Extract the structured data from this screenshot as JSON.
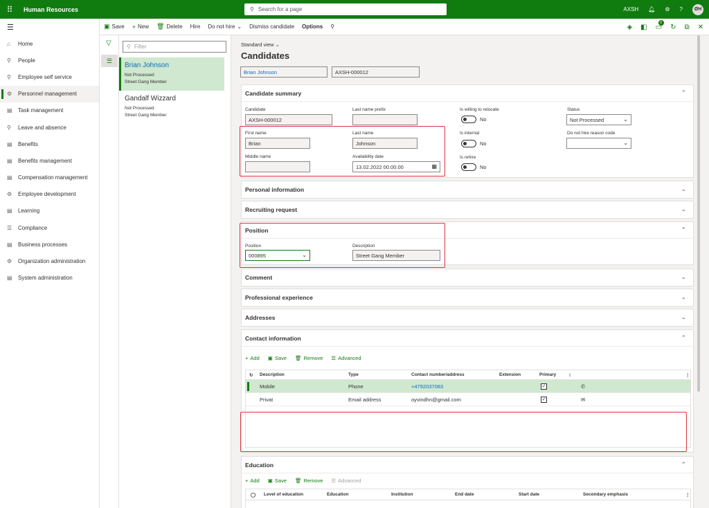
{
  "app": {
    "title": "Human Resources",
    "search_placeholder": "Search for a page",
    "company": "AXSH",
    "user_initials": "ØH"
  },
  "actions": {
    "save": "Save",
    "new": "New",
    "delete": "Delete",
    "hire": "Hire",
    "do_not_hire": "Do not hire",
    "dismiss": "Dismiss candidate",
    "options": "Options",
    "notif_count": "0"
  },
  "nav": {
    "items": [
      {
        "label": "Home",
        "icon": "⌂"
      },
      {
        "label": "People",
        "icon": "⚲"
      },
      {
        "label": "Employee self service",
        "icon": "⚲"
      },
      {
        "label": "Personnel management",
        "icon": "⚙"
      },
      {
        "label": "Task management",
        "icon": "▤"
      },
      {
        "label": "Leave and absence",
        "icon": "⚲"
      },
      {
        "label": "Benefits",
        "icon": "▤"
      },
      {
        "label": "Benefits management",
        "icon": "▤"
      },
      {
        "label": "Compensation management",
        "icon": "▤"
      },
      {
        "label": "Employee development",
        "icon": "⚙"
      },
      {
        "label": "Learning",
        "icon": "▤"
      },
      {
        "label": "Compliance",
        "icon": "☰"
      },
      {
        "label": "Business processes",
        "icon": "▤"
      },
      {
        "label": "Organization administration",
        "icon": "⚙"
      },
      {
        "label": "System administration",
        "icon": "▤"
      }
    ],
    "active": "Personnel management"
  },
  "list": {
    "filter_placeholder": "Filter",
    "records": [
      {
        "name": "Brian Johnson",
        "status": "Not Processed",
        "position": "Street Gang Member"
      },
      {
        "name": "Gandalf Wizzard",
        "status": "Not Processed",
        "position": "Street Gang Member"
      }
    ]
  },
  "page": {
    "view": "Standard view",
    "title": "Candidates",
    "header_name": "Brian Johnson",
    "header_id": "AXSH-000012"
  },
  "summary": {
    "title": "Candidate summary",
    "candidate_label": "Candidate",
    "candidate_value": "AXSH-000012",
    "last_name_prefix_label": "Last name prefix",
    "last_name_prefix_value": "",
    "first_name_label": "First name",
    "first_name_value": "Brian",
    "last_name_label": "Last name",
    "last_name_value": "Johnson",
    "middle_name_label": "Middle name",
    "middle_name_value": "",
    "availability_label": "Availability date",
    "availability_value": "13.02.2022 00.00.00",
    "relocate_label": "Is willing to relocate",
    "relocate_value": "No",
    "internal_label": "Is internal",
    "internal_value": "No",
    "rehire_label": "Is rehire",
    "rehire_value": "No",
    "status_label": "Status",
    "status_value": "Not Processed",
    "dnh_reason_label": "Do not hire reason code",
    "dnh_reason_value": ""
  },
  "sections": {
    "personal": "Personal information",
    "recruiting": "Recruiting request",
    "position": "Position",
    "comment": "Comment",
    "experience": "Professional experience",
    "addresses": "Addresses",
    "contact": "Contact information",
    "education": "Education"
  },
  "position": {
    "position_label": "Position",
    "position_value": "000895",
    "description_label": "Description",
    "description_value": "Street Gang Member"
  },
  "contact": {
    "tools": {
      "add": "Add",
      "save": "Save",
      "remove": "Remove",
      "advanced": "Advanced"
    },
    "columns": {
      "description": "Description",
      "type": "Type",
      "contact": "Contact number/address",
      "extension": "Extension",
      "primary": "Primary"
    },
    "rows": [
      {
        "description": "Mobile",
        "type": "Phone",
        "contact": "+4792037083",
        "extension": "",
        "primary": "✓",
        "icon": "phone-icon"
      },
      {
        "description": "Privat",
        "type": "Email address",
        "contact": "oyvindhn@gmail.com",
        "extension": "",
        "primary": "✓",
        "icon": "mail-icon"
      }
    ]
  },
  "education": {
    "tools": {
      "add": "Add",
      "save": "Save",
      "remove": "Remove",
      "advanced": "Advanced"
    },
    "columns": {
      "level": "Level of education",
      "education": "Education",
      "institution": "Institution",
      "end_date": "End date",
      "start_date": "Start date",
      "secondary": "Secondary emphasis"
    }
  },
  "colors": {
    "brand": "#107c10",
    "highlight": "#e0303a",
    "link": "#0f6cbd"
  }
}
